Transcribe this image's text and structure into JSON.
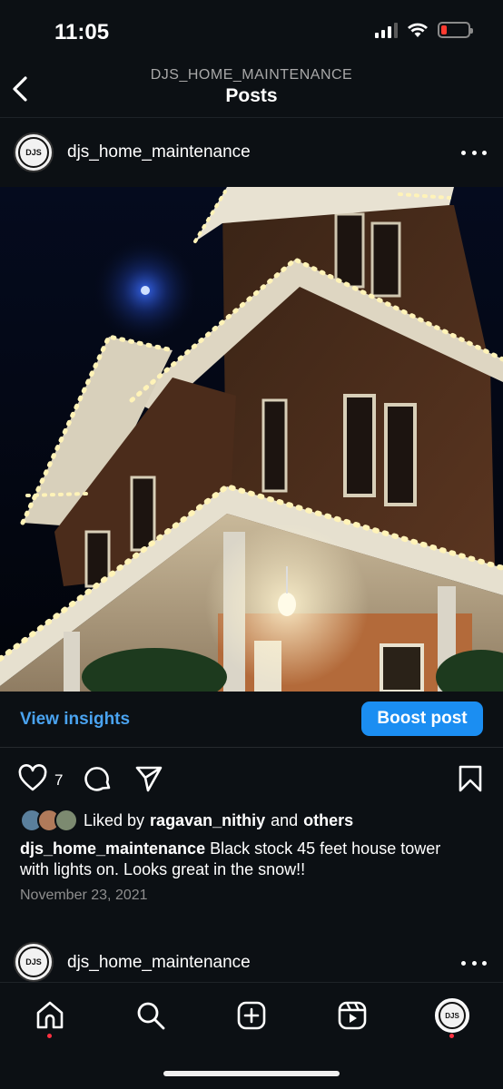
{
  "status": {
    "time": "11:05"
  },
  "header": {
    "subtitle": "DJS_HOME_MAINTENANCE",
    "title": "Posts"
  },
  "post": {
    "username": "djs_home_maintenance",
    "avatar_text": "DJS",
    "view_insights_label": "View insights",
    "boost_label": "Boost post",
    "like_count": "7",
    "liked_by_prefix": "Liked by",
    "liked_by_user": "ragavan_nithiy",
    "liked_by_and": "and",
    "liked_by_others": "others",
    "caption_user": "djs_home_maintenance",
    "caption_text": "Black stock 45 feet house tower with lights on. Looks great in the snow!!",
    "date": "November 23, 2021"
  },
  "next_post": {
    "username": "djs_home_maintenance",
    "avatar_text": "DJS"
  },
  "icons": {
    "back": "chevron-left-icon",
    "like": "heart-icon",
    "comment": "comment-icon",
    "share": "send-icon",
    "save": "bookmark-icon",
    "more": "more-horizontal-icon"
  },
  "colors": {
    "accent": "#1b8ef2",
    "link": "#4aa3f0",
    "background": "#0c1014",
    "notification_dot": "#ff3040"
  },
  "tabs": [
    "home",
    "search",
    "create",
    "reels",
    "profile"
  ]
}
